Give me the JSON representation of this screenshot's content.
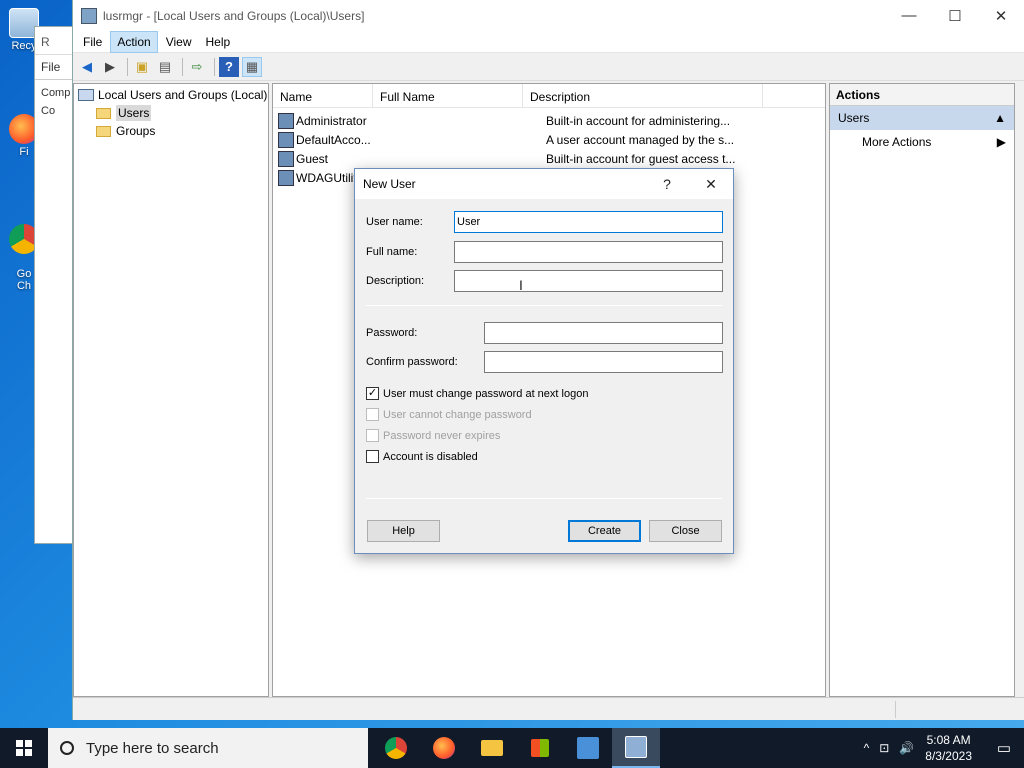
{
  "desktop": {
    "icons": [
      {
        "label": "Recy",
        "icon": "recycle-bin-icon"
      },
      {
        "label": "Fi",
        "icon": "firefox-icon"
      },
      {
        "label": "Go\nCh",
        "icon": "chrome-icon"
      }
    ],
    "bg_window": {
      "title": "R",
      "menu": "File",
      "tree_top": "Comp",
      "tree_item": "Co"
    }
  },
  "window": {
    "title": "lusrmgr - [Local Users and Groups (Local)\\Users]",
    "controls": {
      "minimize": "—",
      "maximize": "☐",
      "close": "✕"
    },
    "menu": [
      "File",
      "Action",
      "View",
      "Help"
    ],
    "active_menu": "Action"
  },
  "tree": {
    "root": "Local Users and Groups (Local)",
    "items": [
      "Users",
      "Groups"
    ],
    "selected": "Users"
  },
  "list": {
    "columns": [
      "Name",
      "Full Name",
      "Description"
    ],
    "rows": [
      {
        "name": "Administrator",
        "full_name": "",
        "description": "Built-in account for administering..."
      },
      {
        "name": "DefaultAcco...",
        "full_name": "",
        "description": "A user account managed by the s..."
      },
      {
        "name": "Guest",
        "full_name": "",
        "description": "Built-in account for guest access t..."
      },
      {
        "name": "WDAGUtilit",
        "full_name": "",
        "description": ""
      }
    ]
  },
  "actions": {
    "header": "Actions",
    "section": "Users",
    "items": [
      "More Actions"
    ]
  },
  "dialog": {
    "title": "New User",
    "help_glyph": "?",
    "close_glyph": "✕",
    "fields": {
      "username_label": "User name:",
      "username_value": "User",
      "fullname_label": "Full name:",
      "fullname_value": "",
      "description_label": "Description:",
      "description_value": "",
      "password_label": "Password:",
      "password_value": "",
      "confirm_label": "Confirm password:",
      "confirm_value": ""
    },
    "checkboxes": [
      {
        "label": "User must change password at next logon",
        "checked": true,
        "enabled": true
      },
      {
        "label": "User cannot change password",
        "checked": false,
        "enabled": false
      },
      {
        "label": "Password never expires",
        "checked": false,
        "enabled": false
      },
      {
        "label": "Account is disabled",
        "checked": false,
        "enabled": true
      }
    ],
    "buttons": {
      "help": "Help",
      "create": "Create",
      "close": "Close"
    }
  },
  "taskbar": {
    "search_placeholder": "Type here to search",
    "apps": [
      "chrome-icon",
      "firefox-icon",
      "file-explorer-icon",
      "store-icon",
      "network-app-icon",
      "lusrmgr-icon"
    ],
    "clock_time": "5:08 AM",
    "clock_date": "8/3/2023",
    "tray": {
      "chevron": "^",
      "network": "⊡",
      "volume": "🔊"
    }
  },
  "colors": {
    "accent": "#0078d7",
    "taskbar": "#101a28",
    "selection": "#c7d8ec"
  }
}
